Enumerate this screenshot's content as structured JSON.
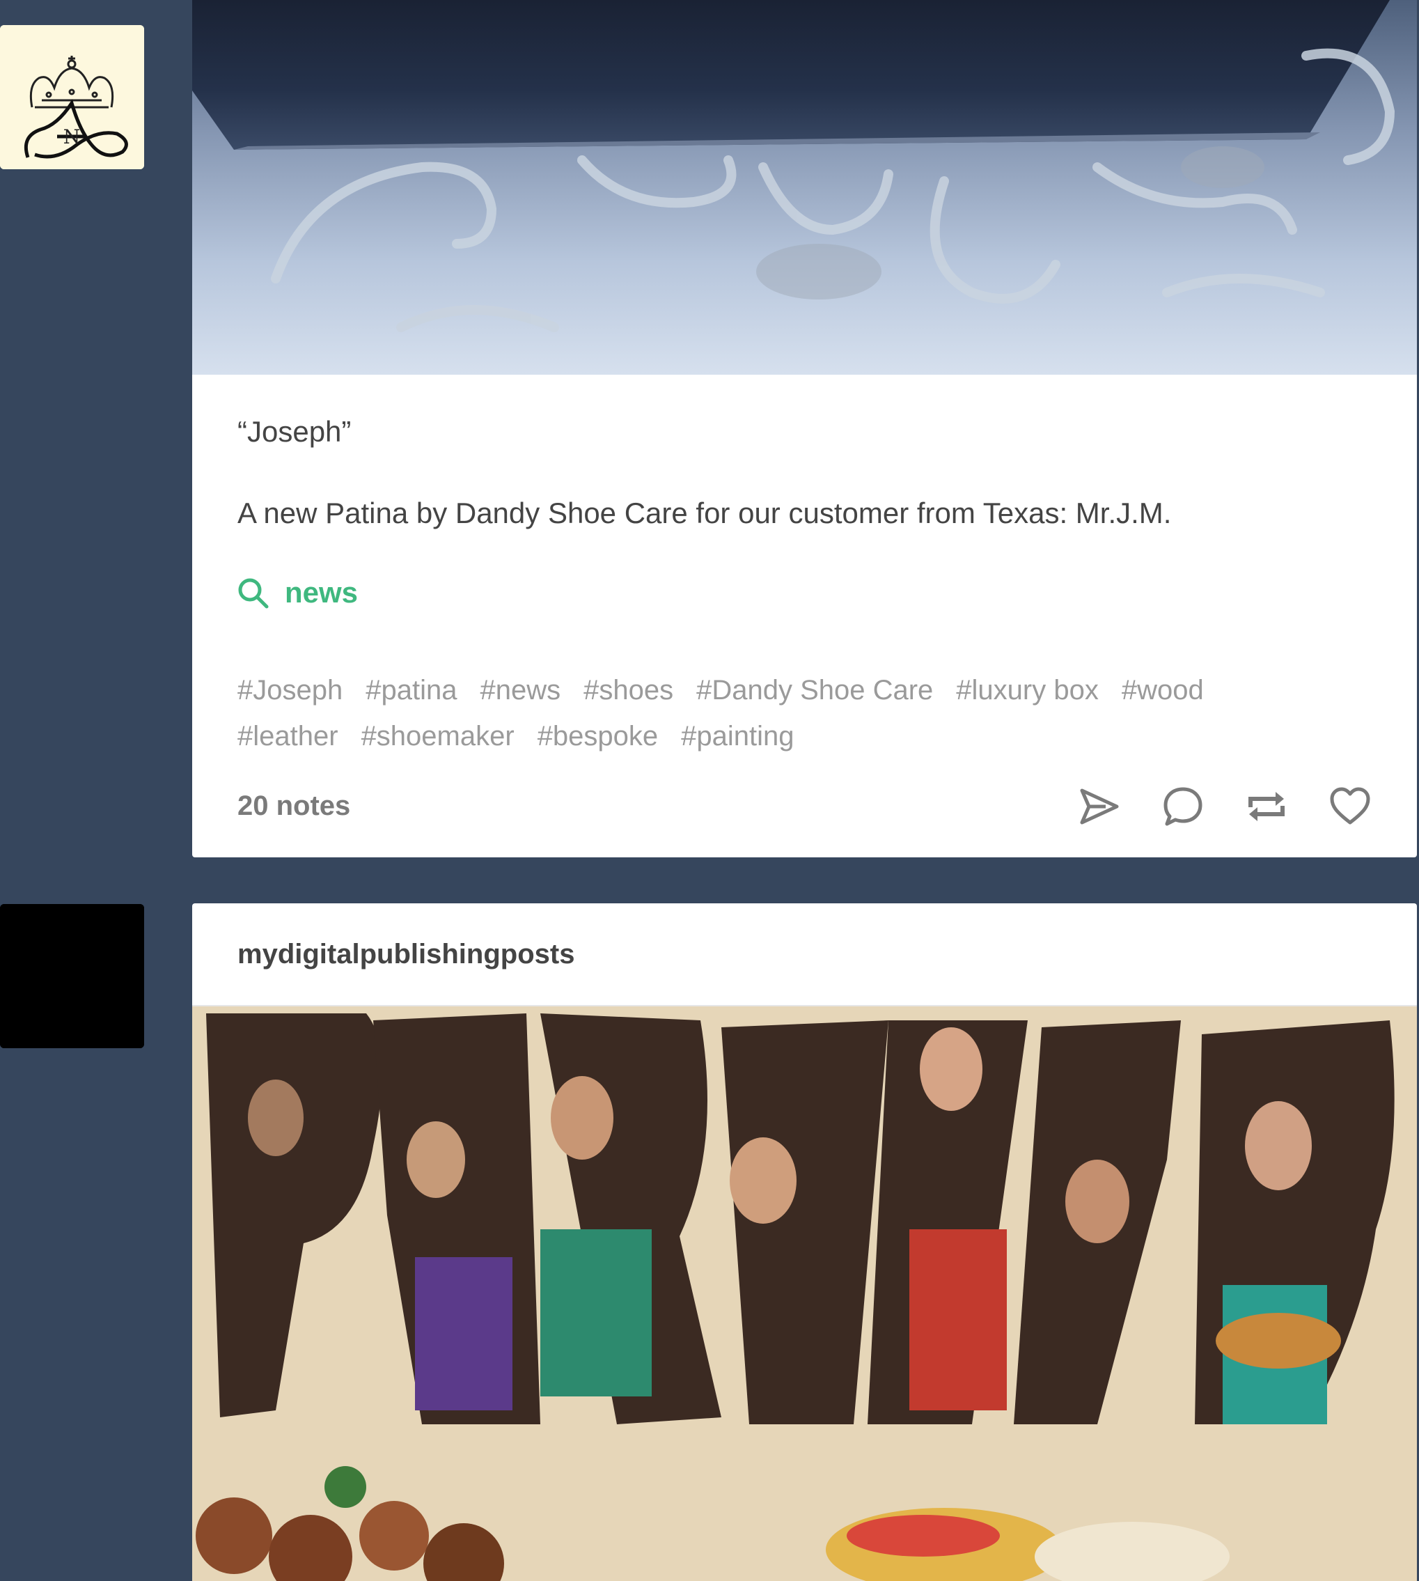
{
  "posts": [
    {
      "avatar_icon": "crown-monogram-logo",
      "photo": "shoe-box-on-wrought-iron-table-photo",
      "title": "“Joseph”",
      "body": "A new Patina by Dandy Shoe Care for our customer from Texas: Mr.J.M.",
      "search_link": "news",
      "tags": [
        "#Joseph",
        "#patina",
        "#news",
        "#shoes",
        "#Dandy Shoe Care",
        "#luxury box",
        "#wood",
        "#leather",
        "#shoemaker",
        "#bespoke",
        "#painting"
      ],
      "notes": "20 notes",
      "actions": [
        "send-icon",
        "reply-icon",
        "reblog-icon",
        "like-icon"
      ],
      "accent_color": "#3fb87f"
    },
    {
      "avatar_icon": "black-avatar",
      "blog_name": "mydigitalpublishingposts",
      "photo": "vintage-party-ad-photo"
    }
  ],
  "colors": {
    "background": "#36465d",
    "card": "#ffffff",
    "text": "#444444",
    "tag": "#9a9a9a"
  }
}
